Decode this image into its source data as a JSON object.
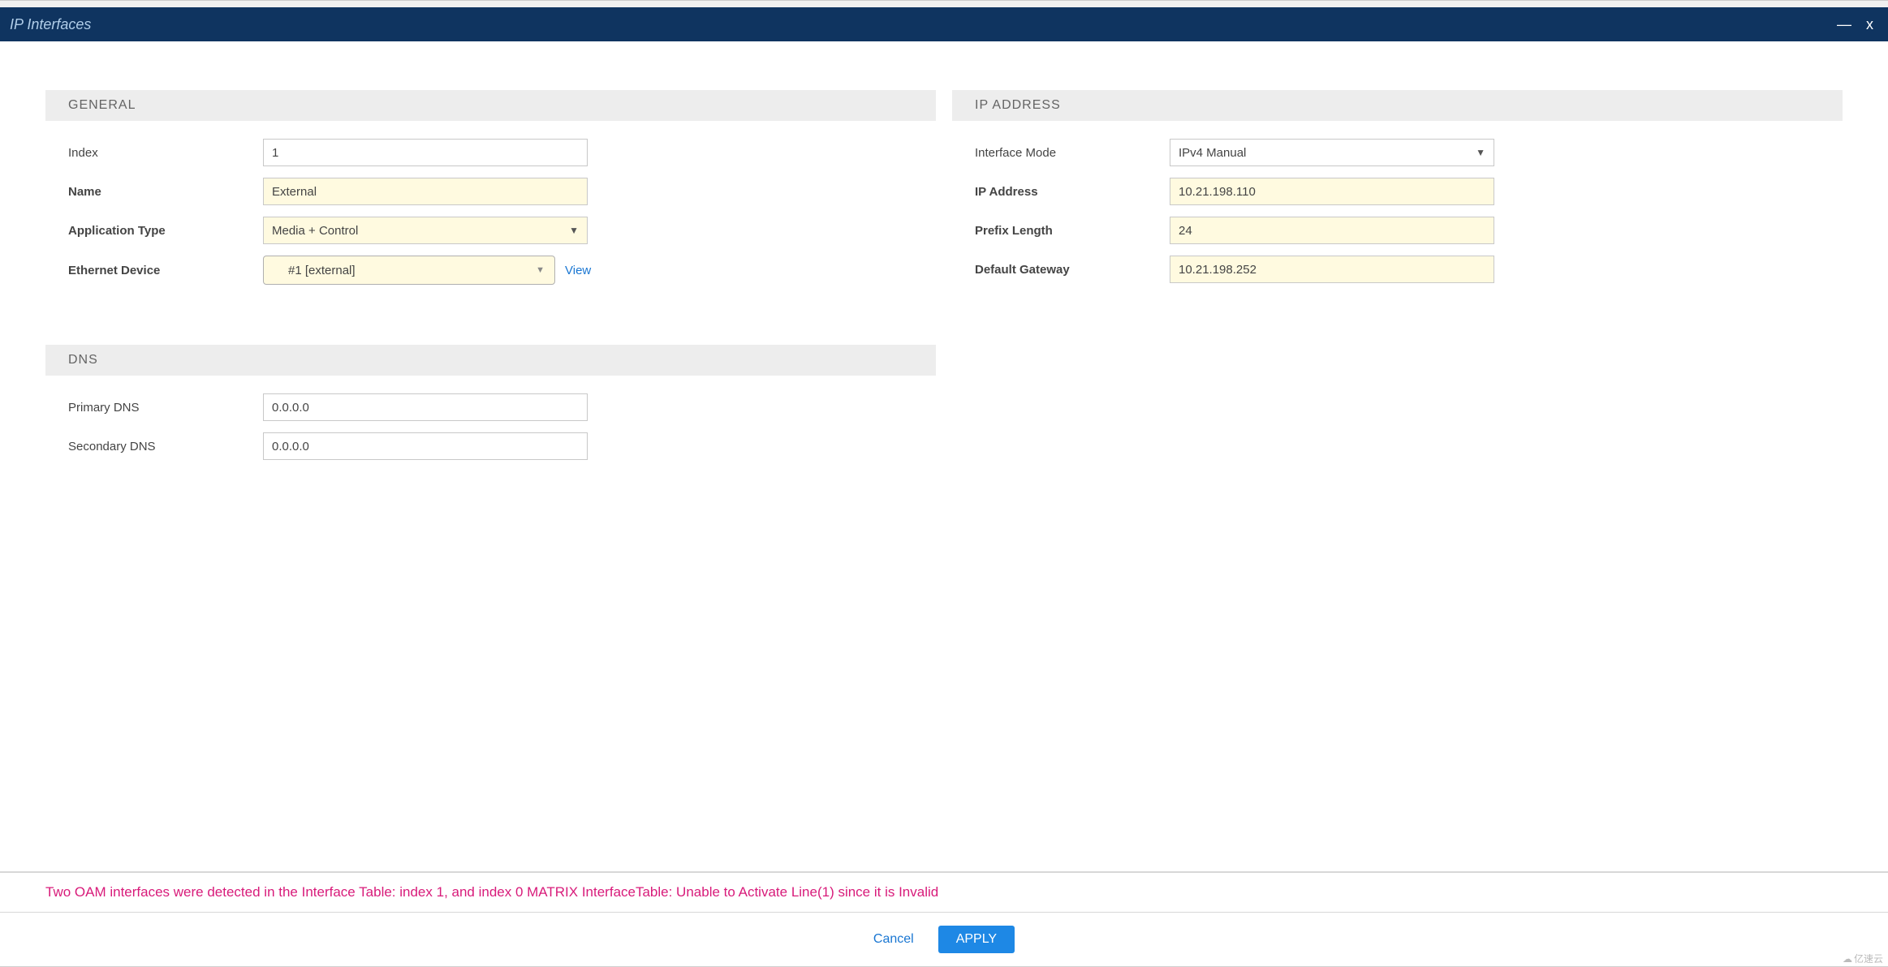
{
  "header": {
    "title": "IP Interfaces"
  },
  "sections": {
    "general": {
      "title": "GENERAL",
      "index_label": "Index",
      "index_value": "1",
      "name_label": "Name",
      "name_value": "External",
      "apptype_label": "Application Type",
      "apptype_value": "Media + Control",
      "ethdev_label": "Ethernet Device",
      "ethdev_value": "#1 [external]",
      "view_link": "View"
    },
    "ipaddress": {
      "title": "IP ADDRESS",
      "mode_label": "Interface Mode",
      "mode_value": "IPv4 Manual",
      "ip_label": "IP Address",
      "ip_value": "10.21.198.110",
      "prefix_label": "Prefix Length",
      "prefix_value": "24",
      "gateway_label": "Default Gateway",
      "gateway_value": "10.21.198.252"
    },
    "dns": {
      "title": "DNS",
      "primary_label": "Primary DNS",
      "primary_value": "0.0.0.0",
      "secondary_label": "Secondary DNS",
      "secondary_value": "0.0.0.0"
    }
  },
  "error_message": "Two OAM interfaces were detected in the Interface Table: index 1, and index 0 MATRIX InterfaceTable: Unable to Activate Line(1) since it is Invalid",
  "buttons": {
    "cancel": "Cancel",
    "apply": "APPLY"
  },
  "watermark": "亿速云"
}
